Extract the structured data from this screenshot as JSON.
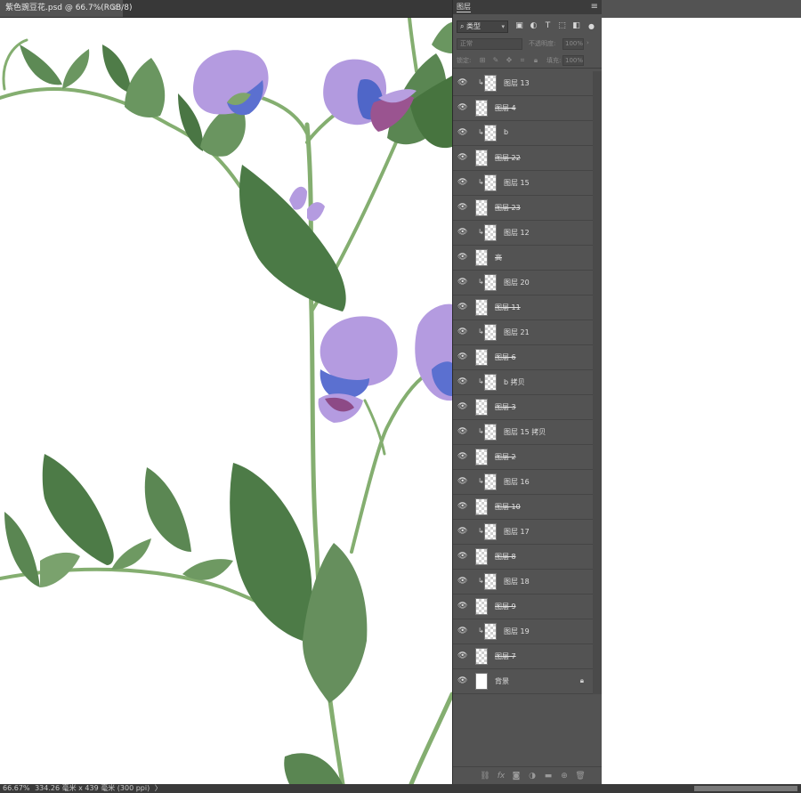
{
  "document": {
    "tab_title": "紫色豌豆花.psd @ 66.7%(RGB/8)",
    "close_glyph": "×"
  },
  "status": {
    "zoom": "66.67%",
    "doc_size": "334.26 毫米 x 439 毫米 (300 ppi)",
    "more": "〉"
  },
  "layers_panel": {
    "tab_label": "图层",
    "menu_glyph": "≡",
    "kind_filter": "类型",
    "blend_mode": "正常",
    "opacity_label": "不透明度:",
    "opacity_value": "100%",
    "lock_label": "锁定:",
    "fill_label": "填充:",
    "fill_value": "100%",
    "layers": [
      {
        "name": "图层 13",
        "clipped": true,
        "strike": false
      },
      {
        "name": "图层 4",
        "clipped": false,
        "strike": true
      },
      {
        "name": "b",
        "clipped": true,
        "strike": false
      },
      {
        "name": "图层 22",
        "clipped": false,
        "strike": true
      },
      {
        "name": "图层 15",
        "clipped": true,
        "strike": false
      },
      {
        "name": "图层 23",
        "clipped": false,
        "strike": true
      },
      {
        "name": "图层 12",
        "clipped": true,
        "strike": false
      },
      {
        "name": "高",
        "clipped": false,
        "strike": true
      },
      {
        "name": "图层 20",
        "clipped": true,
        "strike": false
      },
      {
        "name": "图层 11",
        "clipped": false,
        "strike": true
      },
      {
        "name": "图层 21",
        "clipped": true,
        "strike": false
      },
      {
        "name": "图层 6",
        "clipped": false,
        "strike": true
      },
      {
        "name": "b 拷贝",
        "clipped": true,
        "strike": false
      },
      {
        "name": "图层 3",
        "clipped": false,
        "strike": true
      },
      {
        "name": "图层 15 拷贝",
        "clipped": true,
        "strike": false
      },
      {
        "name": "图层 2",
        "clipped": false,
        "strike": true
      },
      {
        "name": "图层 16",
        "clipped": true,
        "strike": false
      },
      {
        "name": "图层 10",
        "clipped": false,
        "strike": true
      },
      {
        "name": "图层 17",
        "clipped": true,
        "strike": false
      },
      {
        "name": "图层 8",
        "clipped": false,
        "strike": true
      },
      {
        "name": "图层 18",
        "clipped": true,
        "strike": false
      },
      {
        "name": "图层 9",
        "clipped": false,
        "strike": true
      },
      {
        "name": "图层 19",
        "clipped": true,
        "strike": false
      },
      {
        "name": "图层 7",
        "clipped": false,
        "strike": true
      },
      {
        "name": "背景",
        "clipped": false,
        "strike": false,
        "background": true,
        "locked": true
      }
    ]
  },
  "colors": {
    "canvas_bg": "#ffffff",
    "panel_bg": "#535353",
    "leaf": "#4f7c4a",
    "leaf_light": "#6f9a63",
    "stem": "#7eaa6a",
    "petal": "#b79be0",
    "petal_blue": "#5a6fd0",
    "petal_magenta": "#8a3f7a"
  }
}
